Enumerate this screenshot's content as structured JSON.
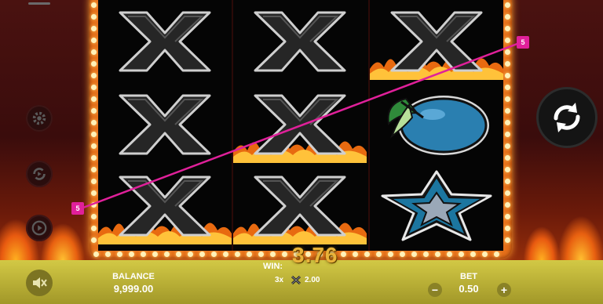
{
  "game": {
    "win_label": "WIN:",
    "win_amount": "3.76",
    "win_multiplier": "3x",
    "win_line_value": "2.00",
    "payline_marker_left": "5",
    "payline_marker_right": "5"
  },
  "footer": {
    "balance_label": "BALANCE",
    "balance_value": "9,999.00",
    "bet_label": "BET",
    "bet_value": "0.50",
    "bet_minus": "−",
    "bet_plus": "+"
  },
  "reels": [
    [
      "x-symbol",
      "x-symbol",
      "x-symbol"
    ],
    [
      "x-symbol",
      "x-symbol",
      "x-symbol"
    ],
    [
      "x-symbol",
      "plum-symbol",
      "star-symbol"
    ]
  ],
  "icons": {
    "menu": "menu-icon",
    "settings": "gear-icon",
    "autoplay": "autoplay-icon",
    "info": "play-info-icon",
    "spin": "spin-icon",
    "sound": "sound-muted-icon"
  },
  "colors": {
    "frame": "#e6701a",
    "bulb": "#fff1b8",
    "payline": "#e0209a",
    "bottom_bar": "#c8be3a",
    "win_amount": "#e9b33a"
  }
}
